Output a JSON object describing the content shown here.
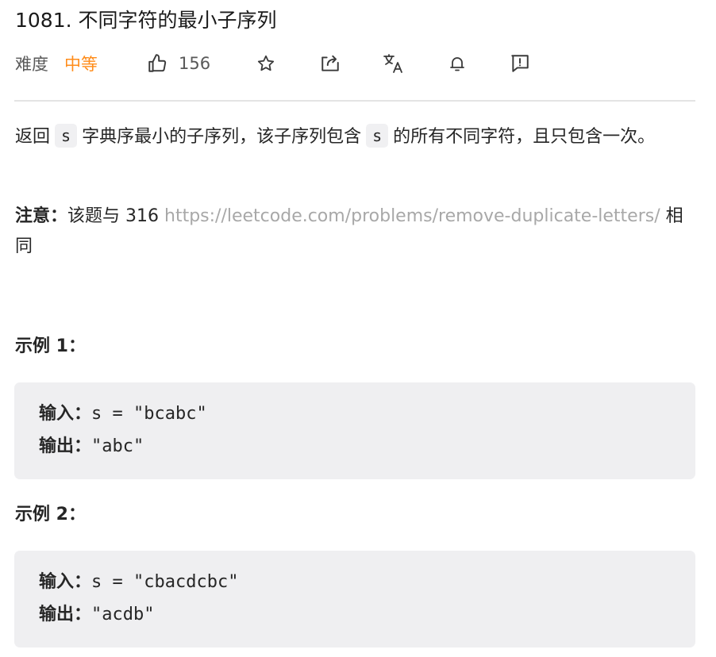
{
  "problem": {
    "title": "1081. 不同字符的最小子序列",
    "difficulty_label": "难度",
    "difficulty_value": "中等",
    "like_count": "156"
  },
  "toolbar": {
    "icons": [
      "thumbs-up-icon",
      "star-icon",
      "share-icon",
      "translate-icon",
      "bell-icon",
      "feedback-icon"
    ]
  },
  "description": {
    "p1_part1": "返回",
    "p1_code1": "s",
    "p1_part2": "字典序最小的子序列，该子序列包含",
    "p1_code2": "s",
    "p1_part3": "的所有不同字符，且只包含一次。",
    "note_label": "注意：",
    "note_text": "该题与 316 ",
    "note_link": "https://leetcode.com/problems/remove-duplicate-letters/",
    "note_suffix": " 相同"
  },
  "examples": [
    {
      "heading": "示例 1：",
      "input_label": "输入：",
      "input_value": "s = \"bcabc\"",
      "output_label": "输出：",
      "output_value": "\"abc\""
    },
    {
      "heading": "示例 2：",
      "input_label": "输入：",
      "input_value": "s = \"cbacdcbc\"",
      "output_label": "输出：",
      "output_value": "\"acdb\""
    }
  ],
  "colors": {
    "difficulty_medium": "#ff8c1a",
    "link": "#a8a8a8",
    "code_bg": "#efeff1"
  }
}
